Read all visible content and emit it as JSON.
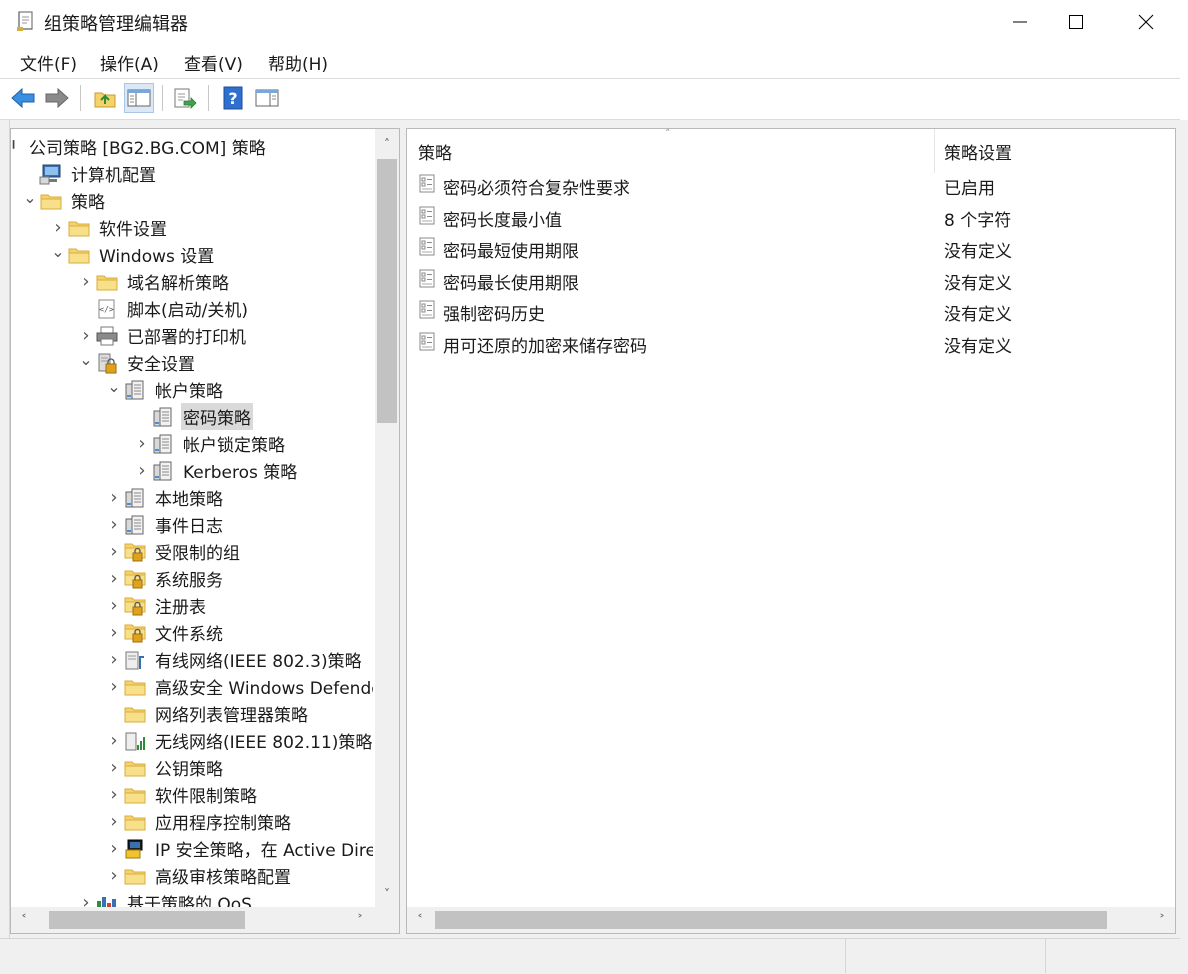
{
  "window": {
    "title": "组策略管理编辑器",
    "icon": "gpo-editor-icon"
  },
  "menu": [
    {
      "label": "文件(F)"
    },
    {
      "label": "操作(A)"
    },
    {
      "label": "查看(V)"
    },
    {
      "label": "帮助(H)"
    }
  ],
  "toolbar": [
    {
      "name": "back",
      "icon": "arrow-left-icon"
    },
    {
      "name": "forward",
      "icon": "arrow-right-icon"
    },
    {
      "name": "up",
      "icon": "folder-up-icon"
    },
    {
      "name": "show-hide-tree",
      "icon": "console-tree-icon"
    },
    {
      "name": "export-list",
      "icon": "export-list-icon"
    },
    {
      "name": "help",
      "icon": "help-icon"
    },
    {
      "name": "show-action-pane",
      "icon": "action-pane-icon"
    }
  ],
  "tree": {
    "rows": [
      {
        "label": "公司策略 [BG2.BG.COM] 策略",
        "icon": "policy-doc-icon",
        "expander": "none"
      },
      {
        "label": "计算机配置",
        "icon": "computer-icon",
        "expander": "none"
      },
      {
        "label": "策略",
        "icon": "folder-icon",
        "expander": "expanded"
      },
      {
        "label": "软件设置",
        "icon": "folder-icon",
        "expander": "collapsed"
      },
      {
        "label": "Windows 设置",
        "icon": "folder-icon",
        "expander": "expanded"
      },
      {
        "label": "域名解析策略",
        "icon": "folder-icon",
        "expander": "collapsed"
      },
      {
        "label": "脚本(启动/关机)",
        "icon": "script-icon",
        "expander": "none"
      },
      {
        "label": "已部署的打印机",
        "icon": "printer-icon",
        "expander": "collapsed"
      },
      {
        "label": "安全设置",
        "icon": "security-settings-icon",
        "expander": "expanded"
      },
      {
        "label": "帐户策略",
        "icon": "policy-server-icon",
        "expander": "expanded"
      },
      {
        "label": "密码策略",
        "icon": "policy-server-icon",
        "expander": "none",
        "selected": true
      },
      {
        "label": "帐户锁定策略",
        "icon": "policy-server-icon",
        "expander": "collapsed"
      },
      {
        "label": "Kerberos 策略",
        "icon": "policy-server-icon",
        "expander": "collapsed"
      },
      {
        "label": "本地策略",
        "icon": "policy-server-icon",
        "expander": "collapsed"
      },
      {
        "label": "事件日志",
        "icon": "policy-server-icon",
        "expander": "collapsed"
      },
      {
        "label": "受限制的组",
        "icon": "locked-folder-icon",
        "expander": "collapsed"
      },
      {
        "label": "系统服务",
        "icon": "locked-folder-icon",
        "expander": "collapsed"
      },
      {
        "label": "注册表",
        "icon": "locked-folder-icon",
        "expander": "collapsed"
      },
      {
        "label": "文件系统",
        "icon": "locked-folder-icon",
        "expander": "collapsed"
      },
      {
        "label": "有线网络(IEEE 802.3)策略",
        "icon": "wired-network-icon",
        "expander": "collapsed"
      },
      {
        "label": "高级安全 Windows Defender",
        "icon": "folder-icon",
        "expander": "collapsed"
      },
      {
        "label": "网络列表管理器策略",
        "icon": "folder-icon",
        "expander": "none"
      },
      {
        "label": "无线网络(IEEE 802.11)策略",
        "icon": "wireless-network-icon",
        "expander": "collapsed"
      },
      {
        "label": "公钥策略",
        "icon": "folder-icon",
        "expander": "collapsed"
      },
      {
        "label": "软件限制策略",
        "icon": "folder-icon",
        "expander": "collapsed"
      },
      {
        "label": "应用程序控制策略",
        "icon": "folder-icon",
        "expander": "collapsed"
      },
      {
        "label": "IP 安全策略，在 Active Directory",
        "icon": "ip-security-icon",
        "expander": "collapsed"
      },
      {
        "label": "高级审核策略配置",
        "icon": "folder-icon",
        "expander": "collapsed"
      },
      {
        "label": "基于策略的 QoS",
        "icon": "qos-chart-icon",
        "expander": "collapsed"
      }
    ]
  },
  "list": {
    "columns": [
      "策略",
      "策略设置"
    ],
    "rows": [
      {
        "policy": "密码必须符合复杂性要求",
        "setting": "已启用"
      },
      {
        "policy": "密码长度最小值",
        "setting": "8 个字符"
      },
      {
        "policy": "密码最短使用期限",
        "setting": "没有定义"
      },
      {
        "policy": "密码最长使用期限",
        "setting": "没有定义"
      },
      {
        "policy": "强制密码历史",
        "setting": "没有定义"
      },
      {
        "policy": "用可还原的加密来储存密码",
        "setting": "没有定义"
      }
    ]
  },
  "colors": {
    "folder": "#f4d36b",
    "folder_edge": "#d8ad3c",
    "selection": "#d9d9d9",
    "help_blue": "#2f6fd0"
  }
}
